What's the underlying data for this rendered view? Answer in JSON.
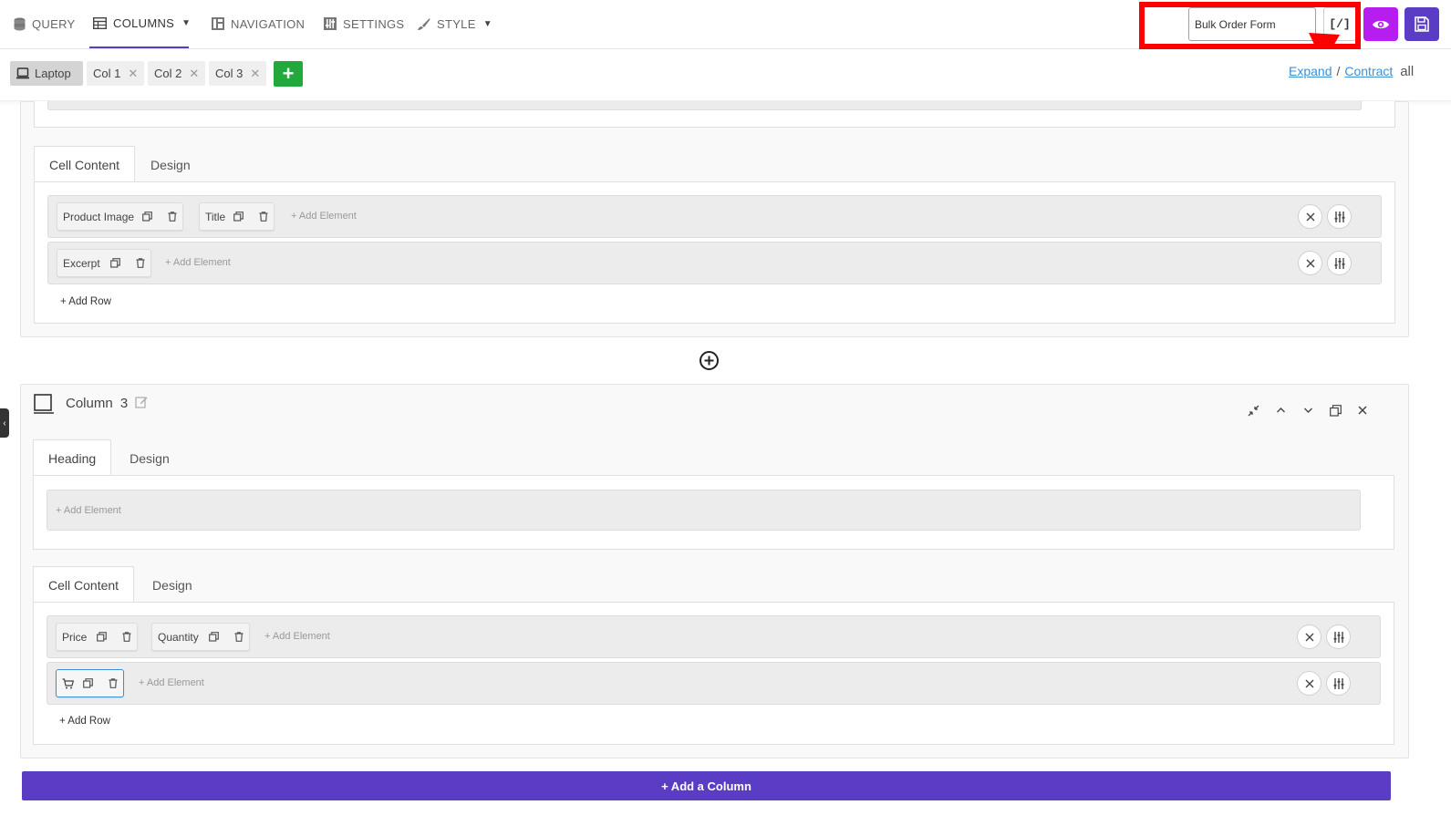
{
  "nav": {
    "tabs": [
      {
        "label": "QUERY",
        "icon": "database-icon"
      },
      {
        "label": "COLUMNS",
        "icon": "table-icon",
        "active": true
      },
      {
        "label": "NAVIGATION",
        "icon": "navigation-icon"
      },
      {
        "label": "SETTINGS",
        "icon": "settings-icon"
      },
      {
        "label": "STYLE",
        "icon": "brush-icon"
      }
    ]
  },
  "header": {
    "title_value": "Bulk Order Form",
    "shortcode_label": "[/]",
    "highlight_color": "#ff0000",
    "preview_color": "#b61ef0",
    "save_color": "#5b3cc4"
  },
  "devicebar": {
    "device": "Laptop",
    "cols": [
      "Col 1",
      "Col 2",
      "Col 3"
    ],
    "add_label": "+",
    "expand": "Expand",
    "separator": "/",
    "contract": "Contract",
    "all": "all"
  },
  "column2": {
    "cell": {
      "tabs": [
        "Cell Content",
        "Design"
      ],
      "rows": [
        {
          "elements": [
            "Product Image",
            "Title"
          ],
          "add": "+ Add Element"
        },
        {
          "elements": [
            "Excerpt"
          ],
          "add": "+ Add Element"
        }
      ],
      "add_row": "+ Add Row"
    }
  },
  "column3": {
    "title": "Column",
    "number": "3",
    "heading": {
      "tabs": [
        "Heading",
        "Design"
      ],
      "add": "+ Add Element"
    },
    "cell": {
      "tabs": [
        "Cell Content",
        "Design"
      ],
      "rows": [
        {
          "elements": [
            "Price",
            "Quantity"
          ],
          "add": "+ Add Element"
        },
        {
          "elements": [
            "cart-icon"
          ],
          "add": "+ Add Element"
        }
      ],
      "add_row": "+ Add Row"
    }
  },
  "footer": {
    "add_column": "+ Add a Column",
    "accent": "#5b3cc4"
  }
}
